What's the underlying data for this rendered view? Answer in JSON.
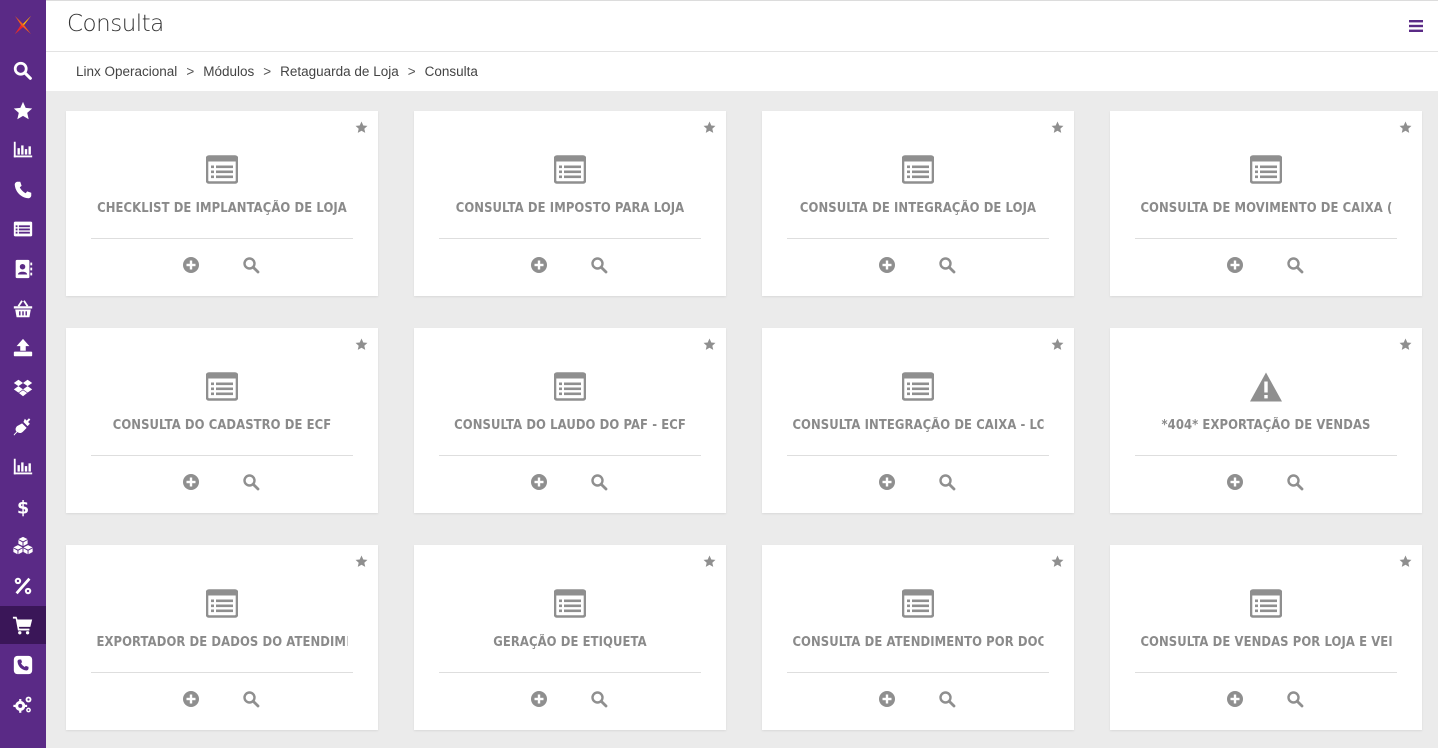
{
  "header": {
    "title": "Consulta"
  },
  "breadcrumb": {
    "items": [
      "Linx Operacional",
      "Módulos",
      "Retaguarda de Loja",
      "Consulta"
    ],
    "separator": ">"
  },
  "colors": {
    "sidebar": "#5a2a86",
    "sidebar_active": "#3a1658",
    "card_text": "#8a8a8a",
    "menu_icon": "#5a2a86"
  },
  "sidebar": {
    "items": [
      {
        "icon": "search-icon"
      },
      {
        "icon": "star-icon"
      },
      {
        "icon": "bar-chart-icon"
      },
      {
        "icon": "phone-icon"
      },
      {
        "icon": "list-icon"
      },
      {
        "icon": "contacts-icon"
      },
      {
        "icon": "basket-icon"
      },
      {
        "icon": "upload-icon"
      },
      {
        "icon": "dropbox-icon"
      },
      {
        "icon": "plug-icon"
      },
      {
        "icon": "bar-chart-icon"
      },
      {
        "icon": "dollar-icon"
      },
      {
        "icon": "cubes-icon"
      },
      {
        "icon": "percent-icon"
      },
      {
        "icon": "cart-icon",
        "active": true
      },
      {
        "icon": "phone-square-icon"
      },
      {
        "icon": "cogs-icon"
      }
    ]
  },
  "cards": [
    {
      "title": "CHECKLIST DE IMPLANTAÇÃO DE LOJA",
      "icon": "list-icon"
    },
    {
      "title": "CONSULTA DE IMPOSTO PARA LOJA",
      "icon": "list-icon"
    },
    {
      "title": "CONSULTA DE INTEGRAÇÃO DE LOJA",
      "icon": "list-icon"
    },
    {
      "title": "CONSULTA DE MOVIMENTO DE CAIXA (LOJA)",
      "icon": "list-icon"
    },
    {
      "title": "CONSULTA DO CADASTRO DE ECF",
      "icon": "list-icon"
    },
    {
      "title": "CONSULTA DO LAUDO DO PAF - ECF",
      "icon": "list-icon"
    },
    {
      "title": "CONSULTA INTEGRAÇÃO DE CAIXA - LOJA",
      "icon": "list-icon"
    },
    {
      "title": "*404* EXPORTAÇÃO DE VENDAS",
      "icon": "warning-icon"
    },
    {
      "title": "EXPORTADOR DE DADOS DO ATENDIMENTO",
      "icon": "list-icon"
    },
    {
      "title": "GERAÇÃO DE ETIQUETA",
      "icon": "list-icon"
    },
    {
      "title": "CONSULTA DE ATENDIMENTO POR DOCUMEN...",
      "icon": "list-icon"
    },
    {
      "title": "CONSULTA DE VENDAS POR LOJA E VENDED...",
      "icon": "list-icon"
    }
  ]
}
